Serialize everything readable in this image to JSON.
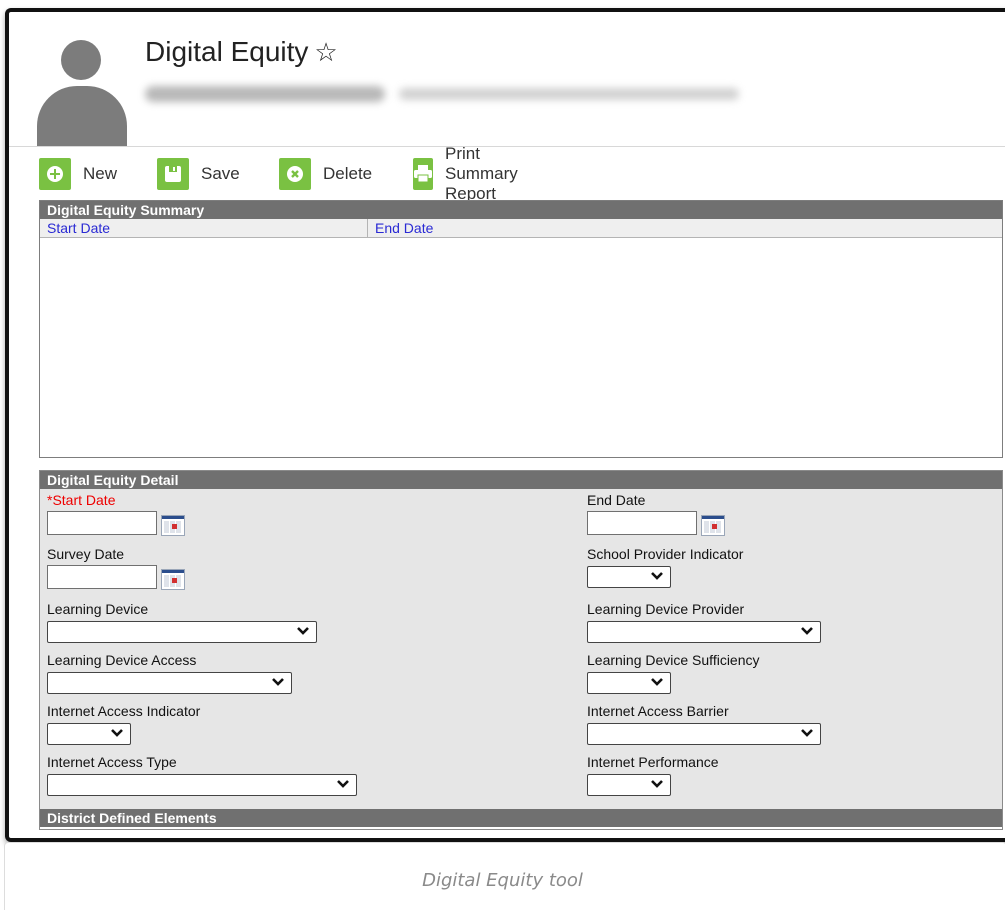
{
  "header": {
    "title": "Digital Equity",
    "star_icon": "star-outline-icon"
  },
  "toolbar": {
    "new_label": "New",
    "save_label": "Save",
    "delete_label": "Delete",
    "print_label": "Print Summary Report",
    "icon_color": "#7ac142"
  },
  "summary": {
    "heading": "Digital Equity Summary",
    "columns": [
      "Start Date",
      "End Date"
    ],
    "rows": []
  },
  "detail": {
    "heading": "Digital Equity Detail",
    "start_date_label": "*Start Date",
    "end_date_label": "End Date",
    "survey_date_label": "Survey Date",
    "school_provider_label": "School Provider Indicator",
    "learning_device_label": "Learning Device",
    "learning_device_provider_label": "Learning Device Provider",
    "learning_device_access_label": "Learning Device Access",
    "learning_device_sufficiency_label": "Learning Device Sufficiency",
    "internet_access_indicator_label": "Internet Access Indicator",
    "internet_access_barrier_label": "Internet Access Barrier",
    "internet_access_type_label": "Internet Access Type",
    "internet_performance_label": "Internet Performance",
    "start_date_value": "",
    "end_date_value": "",
    "survey_date_value": ""
  },
  "district": {
    "heading": "District Defined Elements"
  },
  "caption": "Digital Equity tool",
  "colors": {
    "required": "#e00000",
    "section_header": "#707070",
    "column_link": "#2a2ad4"
  }
}
